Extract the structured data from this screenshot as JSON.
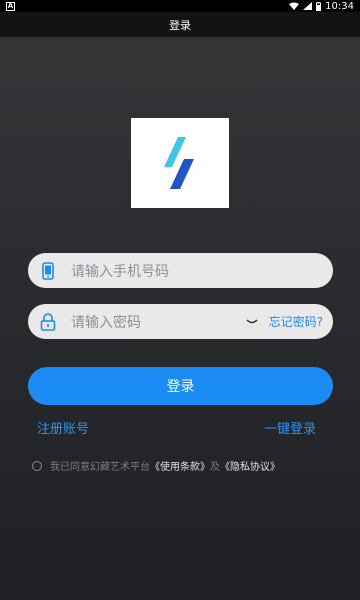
{
  "status_bar": {
    "left_glyph": "A",
    "time": "10:34"
  },
  "header": {
    "title": "登录"
  },
  "logo": {
    "icon": "slash-logo",
    "colors": {
      "cyan": "#3cc7e6",
      "blue": "#1e57c3"
    }
  },
  "form": {
    "phone": {
      "icon": "phone-icon",
      "placeholder": "请输入手机号码"
    },
    "password": {
      "icon": "lock-icon",
      "placeholder": "请输入密码",
      "eye_icon": "eye-closed-icon",
      "forgot_label": "忘记密码?"
    },
    "submit_label": "登录"
  },
  "links": {
    "register": "注册账号",
    "one_click_login": "一键登录"
  },
  "agreement": {
    "prefix": "我已同意幻藏艺术平台",
    "terms": "《使用条款》",
    "and": "及",
    "privacy": "《隐私协议》"
  },
  "colors": {
    "accent": "#1a8cf3",
    "link": "#2a94f2",
    "field_bg": "#e9e9ea"
  }
}
